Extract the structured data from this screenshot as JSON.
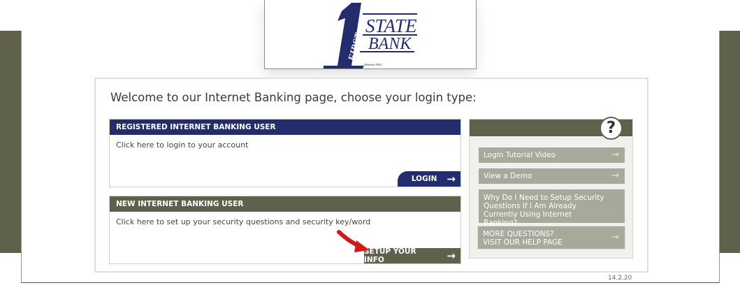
{
  "bank": {
    "logo_words": [
      "FIRST",
      "STATE",
      "BANK"
    ],
    "logo_numeral": "1",
    "member_fdic": "Member FDIC",
    "brand_navy": "#232d6e",
    "brand_olive": "#5f614d"
  },
  "welcome": {
    "heading": "Welcome to our Internet Banking page, choose your login type:"
  },
  "registered": {
    "title": "REGISTERED INTERNET BANKING USER",
    "description": "Click here to login to your account",
    "button_label": "LOGIN",
    "button_icon": "arrow-right-icon"
  },
  "new_user": {
    "title": "NEW INTERNET BANKING USER",
    "description": "Click here to set up your security questions and security key/word",
    "button_label": "SETUP YOUR INFO",
    "button_icon": "arrow-right-icon",
    "pointer_icon": "red-pointer-arrow-icon"
  },
  "help": {
    "header_icon": "question-mark-icon",
    "header_glyph": "?",
    "items": [
      {
        "label": "Login Tutorial Video",
        "icon": "arrow-right-icon"
      },
      {
        "label": "View a Demo",
        "icon": "arrow-right-icon"
      },
      {
        "label": "Why Do I Need to Setup Security Questions If I Am Already Currently Using Internet Banking?",
        "icon": ""
      },
      {
        "label": "MORE QUESTIONS?\nVISIT OUR HELP PAGE",
        "icon": "arrow-right-icon"
      }
    ]
  },
  "footer": {
    "version": "14.2.20"
  }
}
